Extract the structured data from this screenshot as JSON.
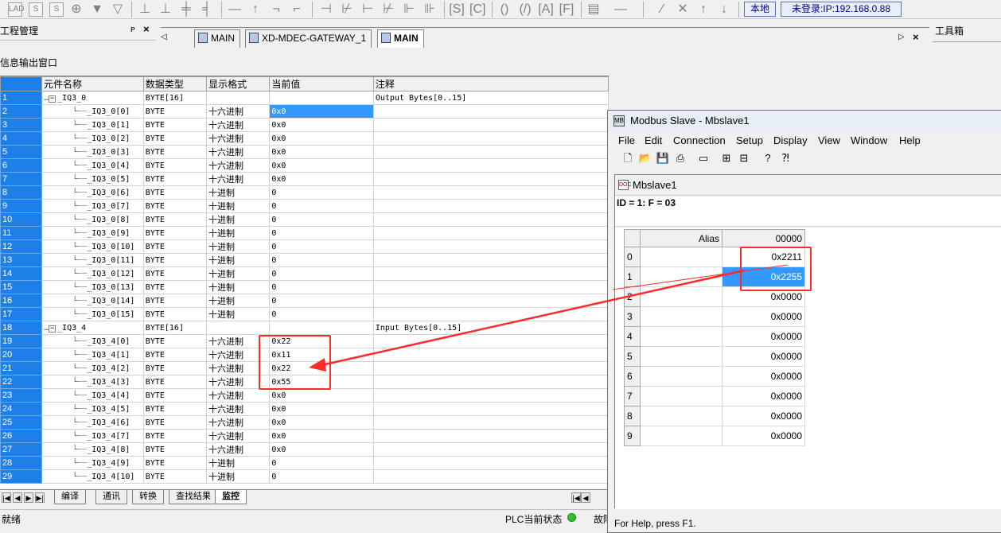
{
  "toolbar": {
    "location_label": "本地",
    "login_status": "未登录:IP:192.168.0.88"
  },
  "project_panel": {
    "title": "工程管理"
  },
  "toolbox_panel": {
    "title": "工具箱"
  },
  "document_tabs": [
    {
      "label": "MAIN",
      "active": false
    },
    {
      "label": "XD-MDEC-GATEWAY_1",
      "active": false
    },
    {
      "label": "MAIN",
      "active": true
    }
  ],
  "info_window": {
    "title": "信息输出窗口"
  },
  "grid": {
    "columns": [
      "元件名称",
      "数据类型",
      "显示格式",
      "当前值",
      "注释"
    ],
    "rows": [
      {
        "n": "1",
        "name": "_IQ3_0",
        "type": "BYTE[16]",
        "fmt": "",
        "val": "",
        "note": "Output Bytes[0..15]",
        "group": true
      },
      {
        "n": "2",
        "name": "_IQ3_0[0]",
        "type": "BYTE",
        "fmt": "十六进制",
        "val": "0x0",
        "note": "",
        "sel": true
      },
      {
        "n": "3",
        "name": "_IQ3_0[1]",
        "type": "BYTE",
        "fmt": "十六进制",
        "val": "0x0",
        "note": ""
      },
      {
        "n": "4",
        "name": "_IQ3_0[2]",
        "type": "BYTE",
        "fmt": "十六进制",
        "val": "0x0",
        "note": ""
      },
      {
        "n": "5",
        "name": "_IQ3_0[3]",
        "type": "BYTE",
        "fmt": "十六进制",
        "val": "0x0",
        "note": ""
      },
      {
        "n": "6",
        "name": "_IQ3_0[4]",
        "type": "BYTE",
        "fmt": "十六进制",
        "val": "0x0",
        "note": ""
      },
      {
        "n": "7",
        "name": "_IQ3_0[5]",
        "type": "BYTE",
        "fmt": "十六进制",
        "val": "0x0",
        "note": ""
      },
      {
        "n": "8",
        "name": "_IQ3_0[6]",
        "type": "BYTE",
        "fmt": "十进制",
        "val": "0",
        "note": ""
      },
      {
        "n": "9",
        "name": "_IQ3_0[7]",
        "type": "BYTE",
        "fmt": "十进制",
        "val": "0",
        "note": ""
      },
      {
        "n": "10",
        "name": "_IQ3_0[8]",
        "type": "BYTE",
        "fmt": "十进制",
        "val": "0",
        "note": ""
      },
      {
        "n": "11",
        "name": "_IQ3_0[9]",
        "type": "BYTE",
        "fmt": "十进制",
        "val": "0",
        "note": ""
      },
      {
        "n": "12",
        "name": "_IQ3_0[10]",
        "type": "BYTE",
        "fmt": "十进制",
        "val": "0",
        "note": ""
      },
      {
        "n": "13",
        "name": "_IQ3_0[11]",
        "type": "BYTE",
        "fmt": "十进制",
        "val": "0",
        "note": ""
      },
      {
        "n": "14",
        "name": "_IQ3_0[12]",
        "type": "BYTE",
        "fmt": "十进制",
        "val": "0",
        "note": ""
      },
      {
        "n": "15",
        "name": "_IQ3_0[13]",
        "type": "BYTE",
        "fmt": "十进制",
        "val": "0",
        "note": ""
      },
      {
        "n": "16",
        "name": "_IQ3_0[14]",
        "type": "BYTE",
        "fmt": "十进制",
        "val": "0",
        "note": ""
      },
      {
        "n": "17",
        "name": "_IQ3_0[15]",
        "type": "BYTE",
        "fmt": "十进制",
        "val": "0",
        "note": ""
      },
      {
        "n": "18",
        "name": "_IQ3_4",
        "type": "BYTE[16]",
        "fmt": "",
        "val": "",
        "note": "Input Bytes[0..15]",
        "group": true
      },
      {
        "n": "19",
        "name": "_IQ3_4[0]",
        "type": "BYTE",
        "fmt": "十六进制",
        "val": "0x22",
        "note": ""
      },
      {
        "n": "20",
        "name": "_IQ3_4[1]",
        "type": "BYTE",
        "fmt": "十六进制",
        "val": "0x11",
        "note": ""
      },
      {
        "n": "21",
        "name": "_IQ3_4[2]",
        "type": "BYTE",
        "fmt": "十六进制",
        "val": "0x22",
        "note": ""
      },
      {
        "n": "22",
        "name": "_IQ3_4[3]",
        "type": "BYTE",
        "fmt": "十六进制",
        "val": "0x55",
        "note": ""
      },
      {
        "n": "23",
        "name": "_IQ3_4[4]",
        "type": "BYTE",
        "fmt": "十六进制",
        "val": "0x0",
        "note": ""
      },
      {
        "n": "24",
        "name": "_IQ3_4[5]",
        "type": "BYTE",
        "fmt": "十六进制",
        "val": "0x0",
        "note": ""
      },
      {
        "n": "25",
        "name": "_IQ3_4[6]",
        "type": "BYTE",
        "fmt": "十六进制",
        "val": "0x0",
        "note": ""
      },
      {
        "n": "26",
        "name": "_IQ3_4[7]",
        "type": "BYTE",
        "fmt": "十六进制",
        "val": "0x0",
        "note": ""
      },
      {
        "n": "27",
        "name": "_IQ3_4[8]",
        "type": "BYTE",
        "fmt": "十六进制",
        "val": "0x0",
        "note": ""
      },
      {
        "n": "28",
        "name": "_IQ3_4[9]",
        "type": "BYTE",
        "fmt": "十进制",
        "val": "0",
        "note": ""
      },
      {
        "n": "29",
        "name": "_IQ3_4[10]",
        "type": "BYTE",
        "fmt": "十进制",
        "val": "0",
        "note": ""
      }
    ]
  },
  "bottom_tabs": [
    {
      "label": "编译",
      "active": false
    },
    {
      "label": "通讯",
      "active": false
    },
    {
      "label": "转换",
      "active": false
    },
    {
      "label": "查找结果",
      "active": false
    },
    {
      "label": "监控",
      "active": true
    }
  ],
  "status_bar": {
    "left": "就绪",
    "plc_state_label": "PLC当前状态",
    "fault_label": "故障"
  },
  "modbus_window": {
    "title": "Modbus Slave - Mbslave1",
    "menu": [
      "File",
      "Edit",
      "Connection",
      "Setup",
      "Display",
      "View",
      "Window",
      "Help"
    ],
    "child_title": "Mbslave1",
    "info_line": "ID = 1: F = 03",
    "columns": {
      "alias": "Alias",
      "address": "00000"
    },
    "rows": [
      {
        "n": "0",
        "value": "0x2211"
      },
      {
        "n": "1",
        "value": "0x2255",
        "sel": true
      },
      {
        "n": "2",
        "value": "0x0000"
      },
      {
        "n": "3",
        "value": "0x0000"
      },
      {
        "n": "4",
        "value": "0x0000"
      },
      {
        "n": "5",
        "value": "0x0000"
      },
      {
        "n": "6",
        "value": "0x0000"
      },
      {
        "n": "7",
        "value": "0x0000"
      },
      {
        "n": "8",
        "value": "0x0000"
      },
      {
        "n": "9",
        "value": "0x0000"
      }
    ],
    "status": "For Help, press F1."
  },
  "colors": {
    "annotation": "#ff2a2a",
    "row_header": "#1c80e8",
    "selection": "#3399ff"
  }
}
